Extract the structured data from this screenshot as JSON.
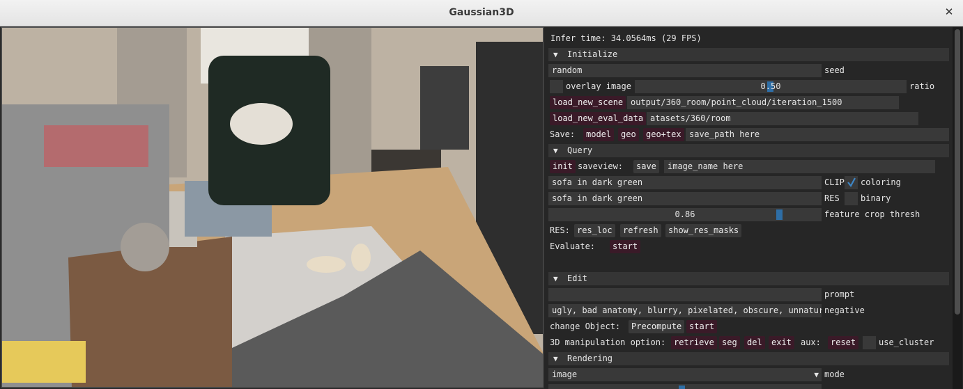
{
  "window": {
    "title": "Gaussian3D",
    "close_label": "✕"
  },
  "panel": {
    "infer_time": "Infer time:  34.0564ms (29 FPS)",
    "initialize": {
      "header": "Initialize",
      "seed_value": "random",
      "seed_label": "seed",
      "overlay_label": "overlay image",
      "overlay_checked": false,
      "ratio_value": "0.50",
      "ratio_fraction": 0.5,
      "ratio_label": "ratio",
      "load_scene_button": "load_new_scene",
      "scene_path": "output/360_room/point_cloud/iteration_1500",
      "load_eval_button": "load_new_eval_data",
      "eval_path": "atasets/360/room",
      "save_label": "Save:",
      "save_model": "model",
      "save_geo": "geo",
      "save_geotex": "geo+tex",
      "save_path": "save_path here"
    },
    "query": {
      "header": "Query",
      "init_button": "init",
      "saveview_label": "saveview:",
      "save_button": "save",
      "image_name": "image_name here",
      "clip_text": "sofa in dark green",
      "clip_label": "CLIP",
      "coloring_checked": true,
      "coloring_label": "coloring",
      "res_text": "sofa in dark green",
      "res_label": "RES",
      "binary_checked": false,
      "binary_label": "binary",
      "thresh_value": "0.86",
      "thresh_fraction": 0.86,
      "thresh_label": "feature crop thresh",
      "res_row_label": "RES:",
      "res_loc_button": "res_loc",
      "refresh_button": "refresh",
      "show_masks_button": "show_res_masks",
      "evaluate_label": "Evaluate:",
      "evaluate_start": "start"
    },
    "edit": {
      "header": "Edit",
      "prompt_value": "",
      "prompt_label": "prompt",
      "negative_value": "ugly, bad anatomy, blurry, pixelated, obscure, unnatura",
      "negative_label": "negative",
      "change_label": "change Object:",
      "precompute_button": "Precompute",
      "change_start": "start",
      "manip_label": "3D manipulation option:",
      "retrieve_button": "retrieve",
      "seg_button": "seg",
      "del_button": "del",
      "exit_button": "exit",
      "aux_label": "aux:",
      "reset_button": "reset",
      "use_cluster_checked": false,
      "use_cluster_label": "use_cluster"
    },
    "rendering": {
      "header": "Rendering",
      "mode_value": "image",
      "mode_label": "mode"
    }
  },
  "colors": {
    "button_bg": "#3a1a28",
    "field_bg": "#393939",
    "slider_grab": "#2e6ea6",
    "header_bg": "#353535"
  },
  "icons": {
    "collapse": "triangle-down-icon",
    "check": "checkmark-icon",
    "dropdown": "dropdown-arrow-icon",
    "close": "close-icon"
  }
}
